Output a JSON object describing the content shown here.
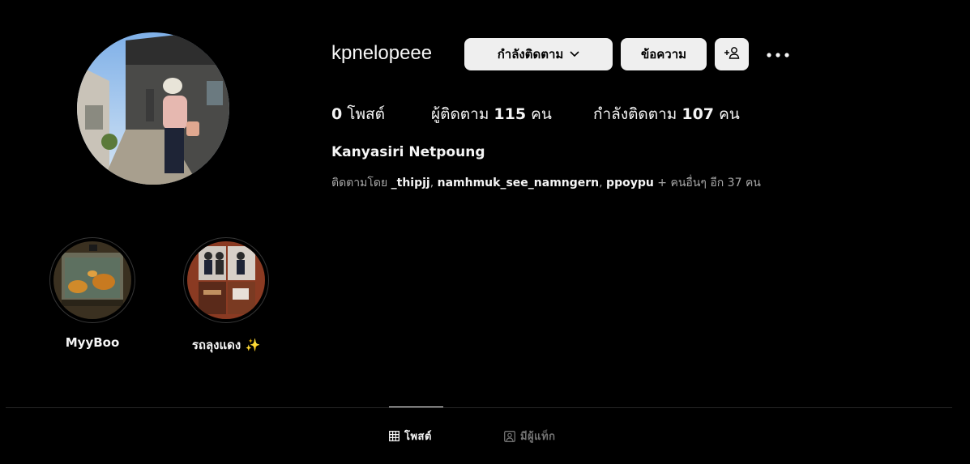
{
  "profile": {
    "username": "kpnelopeee",
    "full_name": "Kanyasiri Netpoung"
  },
  "actions": {
    "following_label": "กำลังติดตาม",
    "message_label": "ข้อความ"
  },
  "stats": {
    "posts_count": "0",
    "posts_label": "โพสต์",
    "followers_label": "ผู้ติดตาม",
    "followers_count": "115",
    "followers_unit": "คน",
    "following_label": "กำลังติดตาม",
    "following_count": "107",
    "following_unit": "คน"
  },
  "followed_by": {
    "prefix": "ติดตามโดย",
    "user1": "_thipjj",
    "sep1": ",",
    "user2": "namhmuk_see_namngern",
    "sep2": ",",
    "user3": "ppoypu",
    "suffix": "+ คนอื่นๆ อีก 37 คน"
  },
  "highlights": [
    {
      "label": "MyyBoo"
    },
    {
      "label": "รถลุงแดง ✨"
    }
  ],
  "tabs": [
    {
      "label": "โพสต์",
      "icon": "grid-icon",
      "active": true
    },
    {
      "label": "มีผู้แท็ก",
      "icon": "tagged-icon",
      "active": false
    }
  ]
}
